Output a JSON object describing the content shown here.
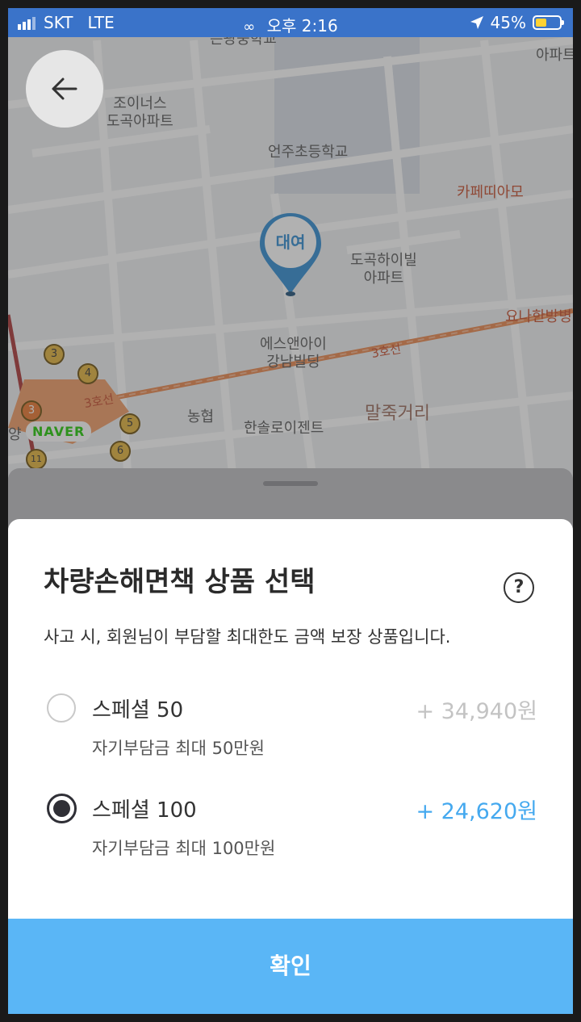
{
  "status_bar": {
    "carrier": "SKT",
    "network": "LTE",
    "time": "오후 2:16",
    "battery": "45%",
    "battery_level": 0.45
  },
  "map": {
    "pin_label": "대여",
    "labels": {
      "top_cut": "은광중학교",
      "top_right": "아파트",
      "joiners": "조이너스\n도곡아파트",
      "school": "언주초등학교",
      "cafe": "카페띠아모",
      "dogok_hill": "도곡하이빌\n아파트",
      "clinic": "요나한방병",
      "snai": "에스앤아이\n강남빌딩",
      "line3_a": "3호선",
      "line3_b": "3호선",
      "nonghyup": "농협",
      "hansol": "한솔로이젠트",
      "maljuk": "말죽거리",
      "left_cut": "양"
    },
    "stations": [
      "3",
      "4",
      "3",
      "5",
      "6",
      "11"
    ],
    "logo": "NAVER"
  },
  "modal": {
    "title": "차량손해면책 상품 선택",
    "help": "?",
    "subtitle": "사고 시, 회원님이 부담할 최대한도 금액 보장 상품입니다.",
    "options": [
      {
        "name": "스페셜 50",
        "desc": "자기부담금 최대 50만원",
        "price": "+ 34,940원",
        "selected": false
      },
      {
        "name": "스페셜 100",
        "desc": "자기부담금 최대 100만원",
        "price": "+ 24,620원",
        "selected": true
      }
    ],
    "confirm_label": "확인"
  },
  "colors": {
    "status_bar": "#3a73c9",
    "accent_blue": "#45a9ef",
    "confirm_button": "#5ab6f6"
  }
}
